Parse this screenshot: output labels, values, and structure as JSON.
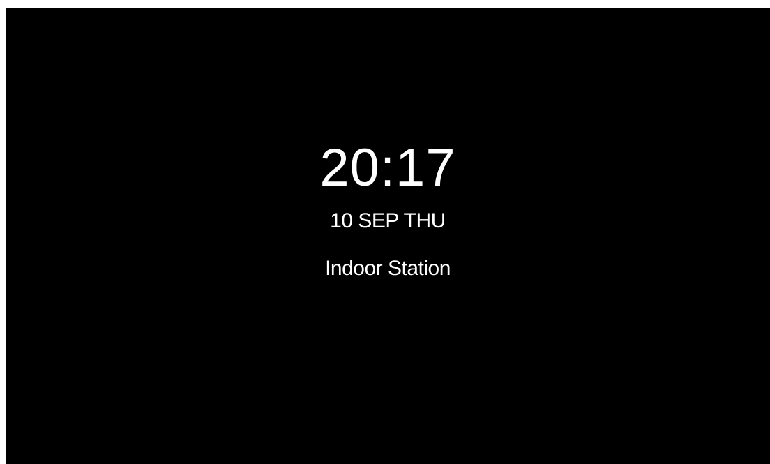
{
  "standby": {
    "time": "20:17",
    "date": "10 SEP THU",
    "device_name": "Indoor Station"
  },
  "colors": {
    "background": "#000000",
    "text": "#ffffff"
  }
}
